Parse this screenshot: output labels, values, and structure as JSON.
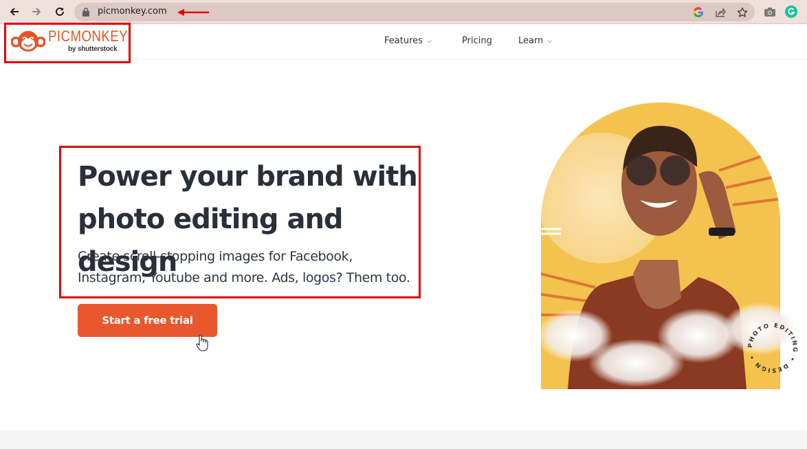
{
  "browser": {
    "url": "picmonkey.com",
    "icons": [
      "back-icon",
      "forward-icon",
      "reload-icon",
      "lock-icon",
      "google-icon",
      "share-icon",
      "bookmark-star-icon",
      "camera-icon",
      "grammarly-icon"
    ],
    "annotation_arrow_color": "#e30000"
  },
  "header": {
    "logo_text": "PICMONKEY",
    "logo_sub": "by shutterstock",
    "brand_color": "#e2542a",
    "nav": [
      {
        "label": "Features",
        "has_dropdown": true
      },
      {
        "label": "Pricing",
        "has_dropdown": false
      },
      {
        "label": "Learn",
        "has_dropdown": true
      }
    ]
  },
  "hero": {
    "title_line1": "Power your brand with",
    "title_line2": "photo editing and design",
    "subtitle_line1": "Create scroll-stopping images for Facebook,",
    "subtitle_line2": "Instagram, Youtube and more. Ads, logos? Them too.",
    "cta_label": "Start a free trial",
    "cta_color": "#e8582c",
    "image_badge_text": "PHOTO EDITING • DESIGN •"
  },
  "annotations": {
    "highlight_color": "#e30000"
  }
}
